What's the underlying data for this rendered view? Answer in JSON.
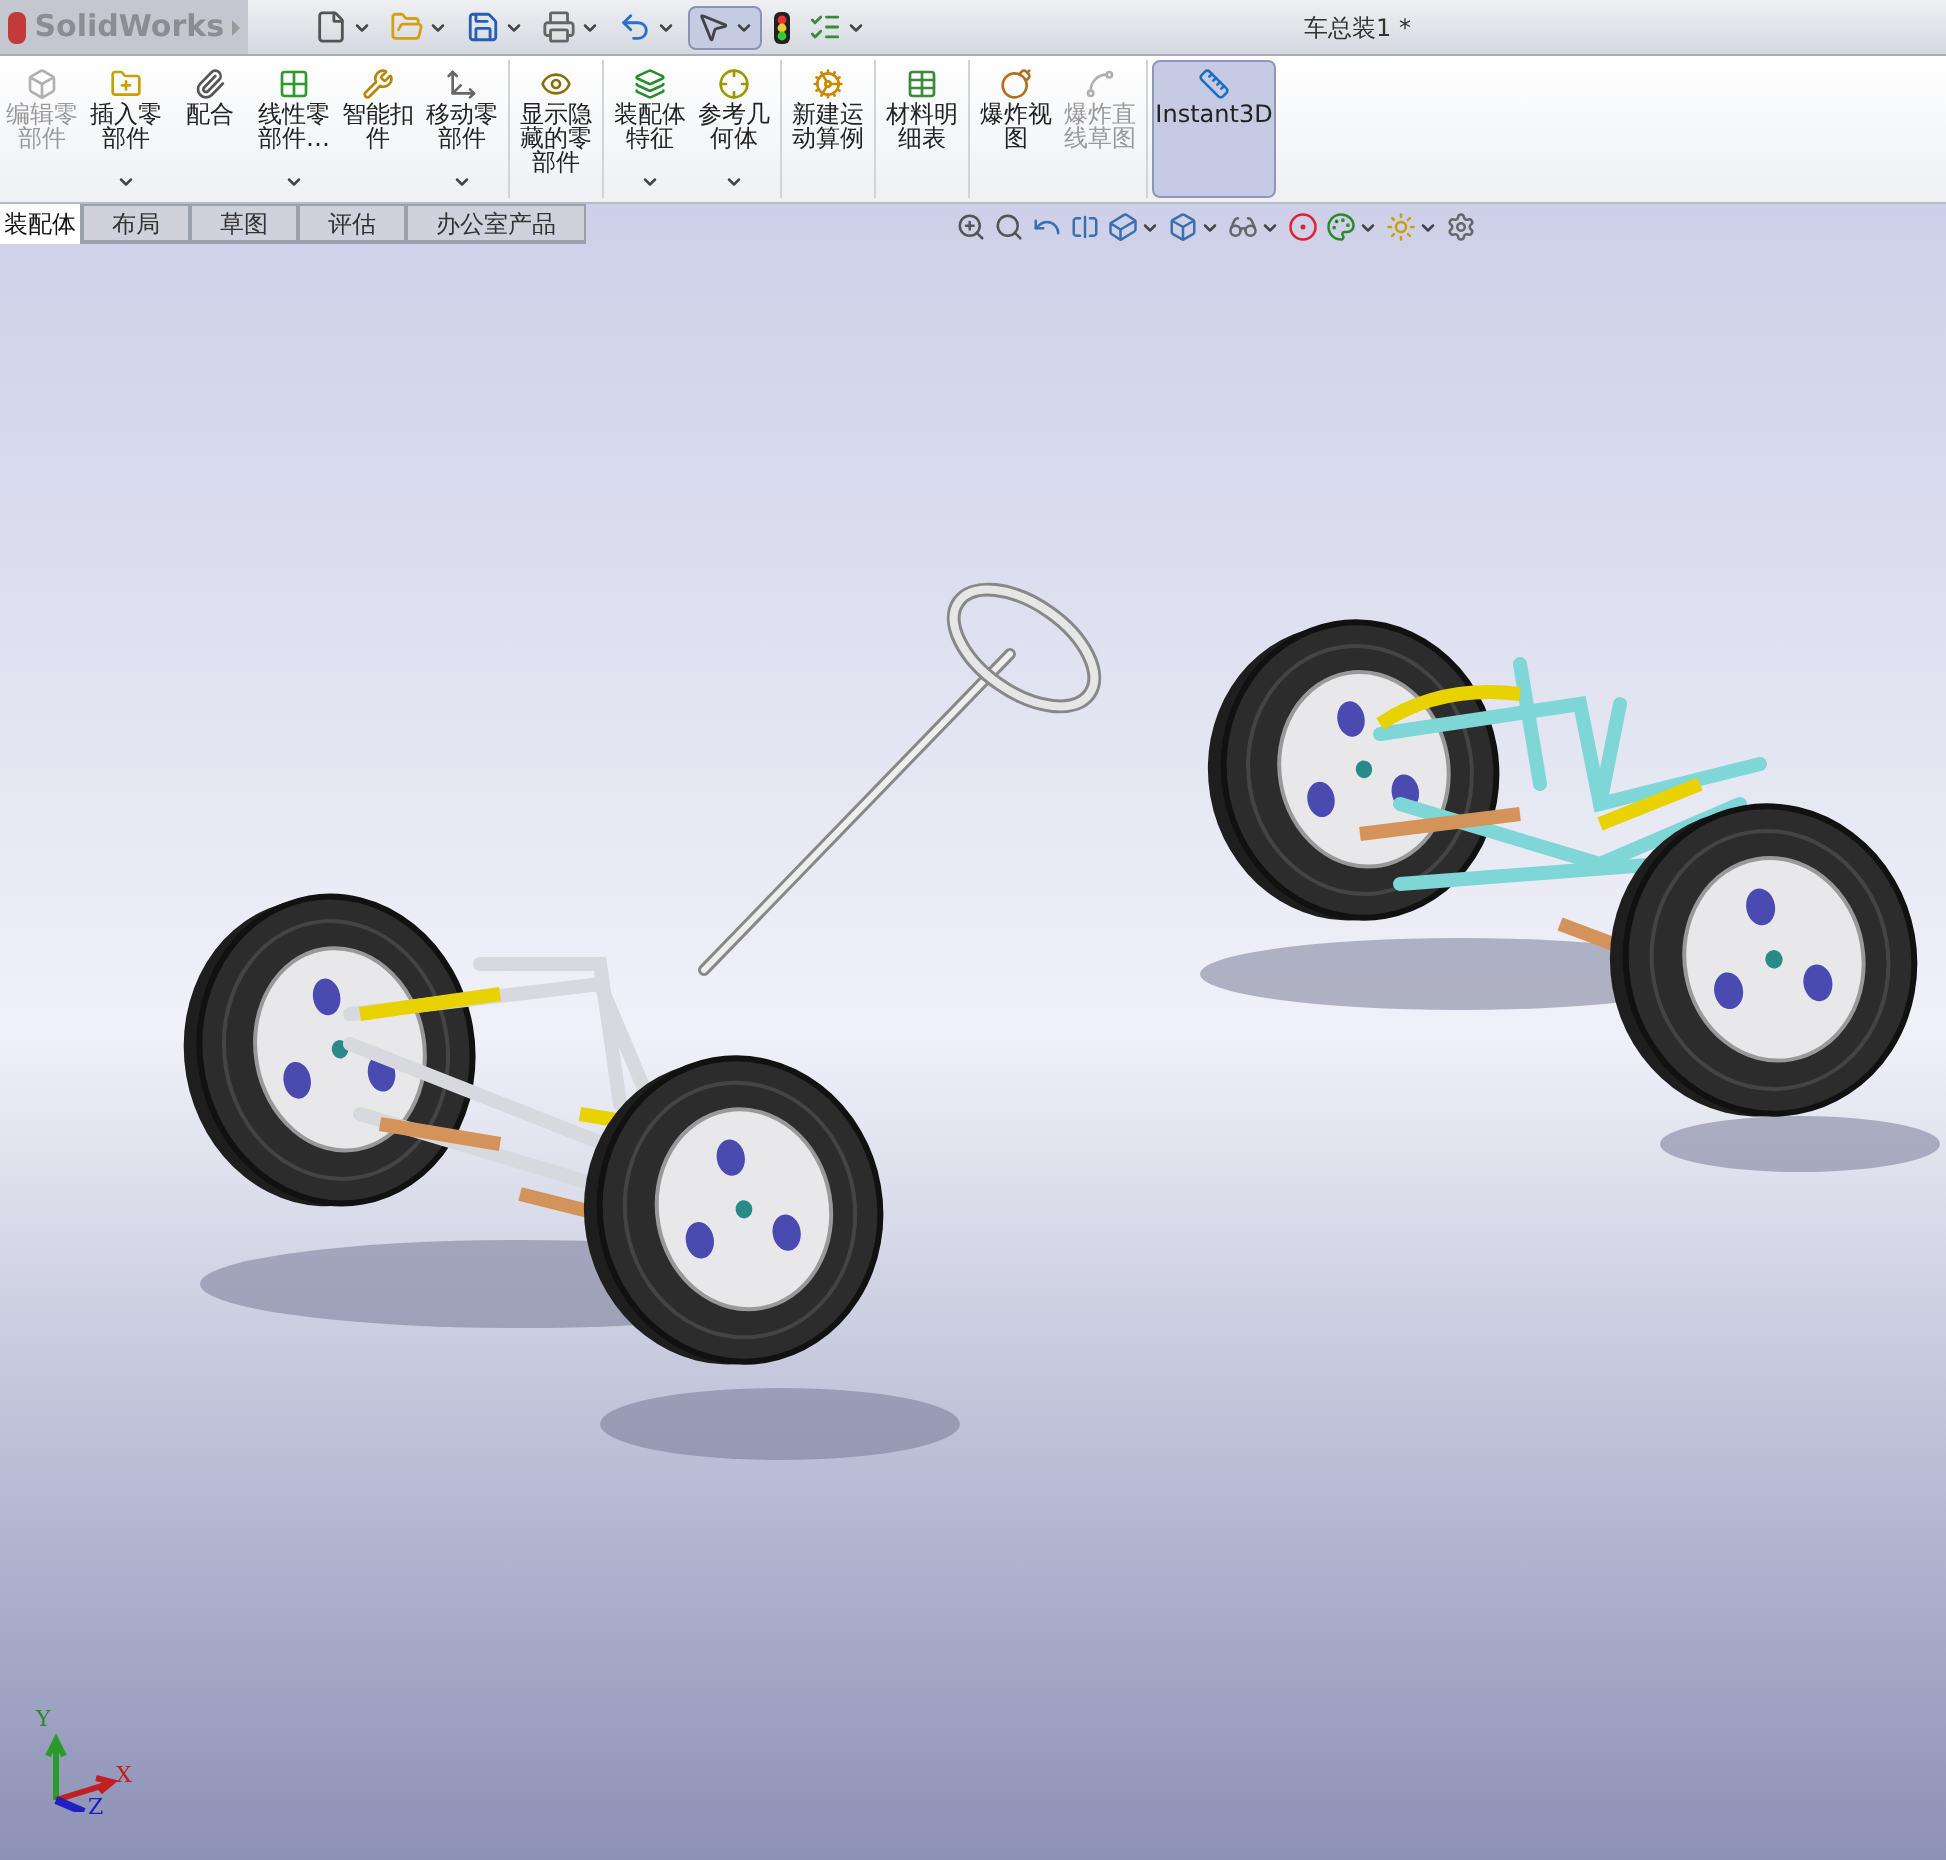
{
  "title_bar": {
    "app_name": "SolidWorks",
    "document_title": "车总装1 *"
  },
  "quick_access": [
    {
      "kind": "new",
      "dropdown": true,
      "selected": false
    },
    {
      "kind": "open",
      "dropdown": true,
      "selected": false
    },
    {
      "kind": "save",
      "dropdown": true,
      "selected": false
    },
    {
      "kind": "print",
      "dropdown": true,
      "selected": false
    },
    {
      "kind": "undo",
      "dropdown": true,
      "selected": false
    },
    {
      "kind": "select",
      "dropdown": true,
      "selected": true
    },
    {
      "kind": "rebuild",
      "dropdown": false,
      "selected": false
    },
    {
      "kind": "options",
      "dropdown": true,
      "selected": false
    }
  ],
  "command_groups": [
    {
      "buttons": [
        {
          "kind": "edit",
          "label": "编辑零部件",
          "disabled": true,
          "dropdown": false,
          "selected": false
        },
        {
          "kind": "insert",
          "label": "插入零部件",
          "disabled": false,
          "dropdown": true,
          "selected": false
        },
        {
          "kind": "mate",
          "label": "配合",
          "disabled": false,
          "dropdown": false,
          "selected": false
        },
        {
          "kind": "pattern",
          "label": "线性零部件…",
          "disabled": false,
          "dropdown": true,
          "selected": false
        },
        {
          "kind": "fastener",
          "label": "智能扣件",
          "disabled": false,
          "dropdown": false,
          "selected": false
        },
        {
          "kind": "move",
          "label": "移动零部件",
          "disabled": false,
          "dropdown": true,
          "selected": false
        }
      ]
    },
    {
      "buttons": [
        {
          "kind": "show",
          "label": "显示隐藏的零部件",
          "disabled": false,
          "dropdown": false,
          "selected": false
        }
      ]
    },
    {
      "buttons": [
        {
          "kind": "feature",
          "label": "装配体特征",
          "disabled": false,
          "dropdown": true,
          "selected": false
        },
        {
          "kind": "reference",
          "label": "参考几何体",
          "disabled": false,
          "dropdown": true,
          "selected": false
        }
      ]
    },
    {
      "buttons": [
        {
          "kind": "motion",
          "label": "新建运动算例",
          "disabled": false,
          "dropdown": false,
          "selected": false
        }
      ]
    },
    {
      "buttons": [
        {
          "kind": "bom",
          "label": "材料明细表",
          "disabled": false,
          "dropdown": false,
          "selected": false
        }
      ]
    },
    {
      "buttons": [
        {
          "kind": "explode",
          "label": "爆炸视图",
          "disabled": false,
          "dropdown": false,
          "selected": false
        },
        {
          "kind": "explode_line",
          "label": "爆炸直线草图",
          "disabled": true,
          "dropdown": false,
          "selected": false
        }
      ]
    },
    {
      "buttons": [
        {
          "kind": "instant3d",
          "label": "Instant3D",
          "disabled": false,
          "dropdown": false,
          "selected": true
        }
      ]
    }
  ],
  "tabs": [
    {
      "label": "装配体",
      "selected": true
    },
    {
      "label": "布局",
      "selected": false
    },
    {
      "label": "草图",
      "selected": false
    },
    {
      "label": "评估",
      "selected": false
    },
    {
      "label": "办公室产品",
      "selected": false
    }
  ],
  "view_toolbar": [
    {
      "kind": "zoom_fit",
      "dropdown": false
    },
    {
      "kind": "zoom_area",
      "dropdown": false
    },
    {
      "kind": "previous_view",
      "dropdown": false
    },
    {
      "kind": "section",
      "dropdown": false
    },
    {
      "kind": "orientation",
      "dropdown": true
    },
    {
      "kind": "display_style",
      "dropdown": true
    },
    {
      "kind": "hide_show",
      "dropdown": true
    },
    {
      "kind": "appearance",
      "dropdown": false
    },
    {
      "kind": "scene",
      "dropdown": true
    },
    {
      "kind": "lights",
      "dropdown": true
    },
    {
      "kind": "settings",
      "dropdown": false
    }
  ],
  "triad": {
    "x": "X",
    "y": "Y",
    "z": "Z"
  }
}
